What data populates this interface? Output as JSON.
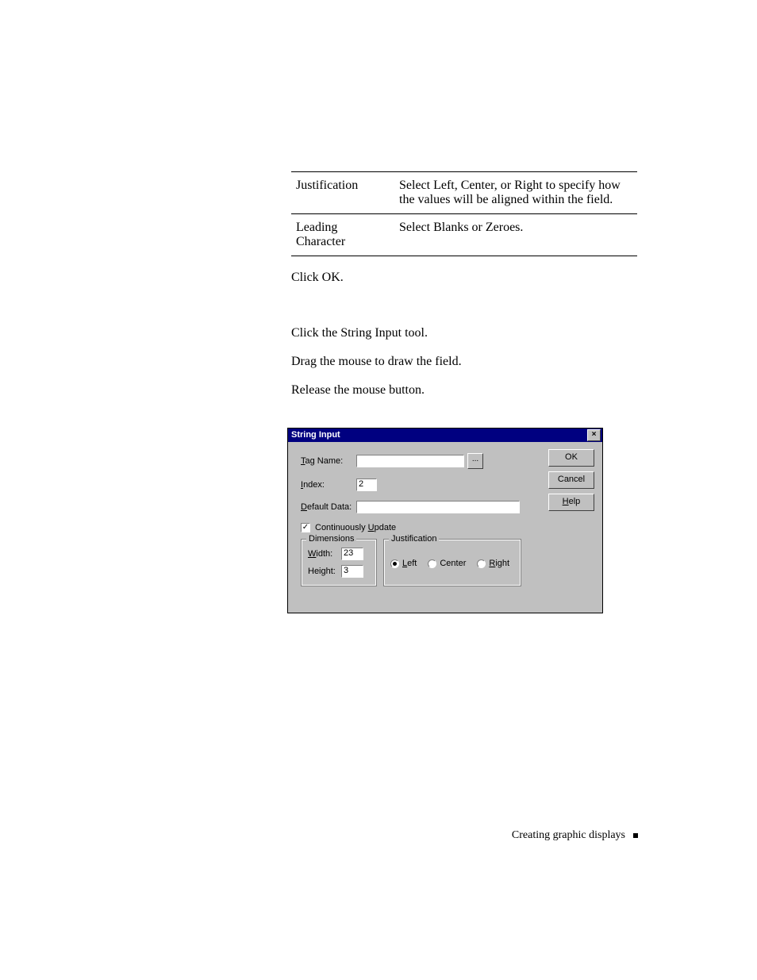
{
  "table": {
    "rows": [
      {
        "name": "Justification",
        "desc": "Select Left, Center, or Right to specify how the values will be aligned within the field."
      },
      {
        "name": "Leading Character",
        "desc": "Select Blanks or Zeroes."
      }
    ]
  },
  "instructions": {
    "p1": "Click OK.",
    "p2": "Click the String Input tool.",
    "p3": "Drag the mouse to draw the field.",
    "p4": "Release the mouse button."
  },
  "dialog": {
    "title": "String Input",
    "close_x": "×",
    "labels": {
      "tag": "Tag Name:",
      "tag_ul": "T",
      "index": "Index:",
      "index_ul": "I",
      "default": "Default Data:",
      "default_ul": "D",
      "continuous": "Continuously Update",
      "continuous_ul": "U",
      "dimensions_legend": "Dimensions",
      "justification_legend": "Justification",
      "width": "Width:",
      "width_ul": "W",
      "height": "Height:",
      "left": "Left",
      "left_ul": "L",
      "center": "Center",
      "right": "Right",
      "right_ul": "R"
    },
    "values": {
      "tag": "",
      "index": "2",
      "default": "",
      "continuous_checked": "✓",
      "width": "23",
      "height": "3",
      "just_selected": "left"
    },
    "browse": "...",
    "buttons": {
      "ok": "OK",
      "cancel": "Cancel",
      "help": "Help",
      "help_ul": "H"
    }
  },
  "footer": {
    "text": "Creating graphic displays"
  }
}
